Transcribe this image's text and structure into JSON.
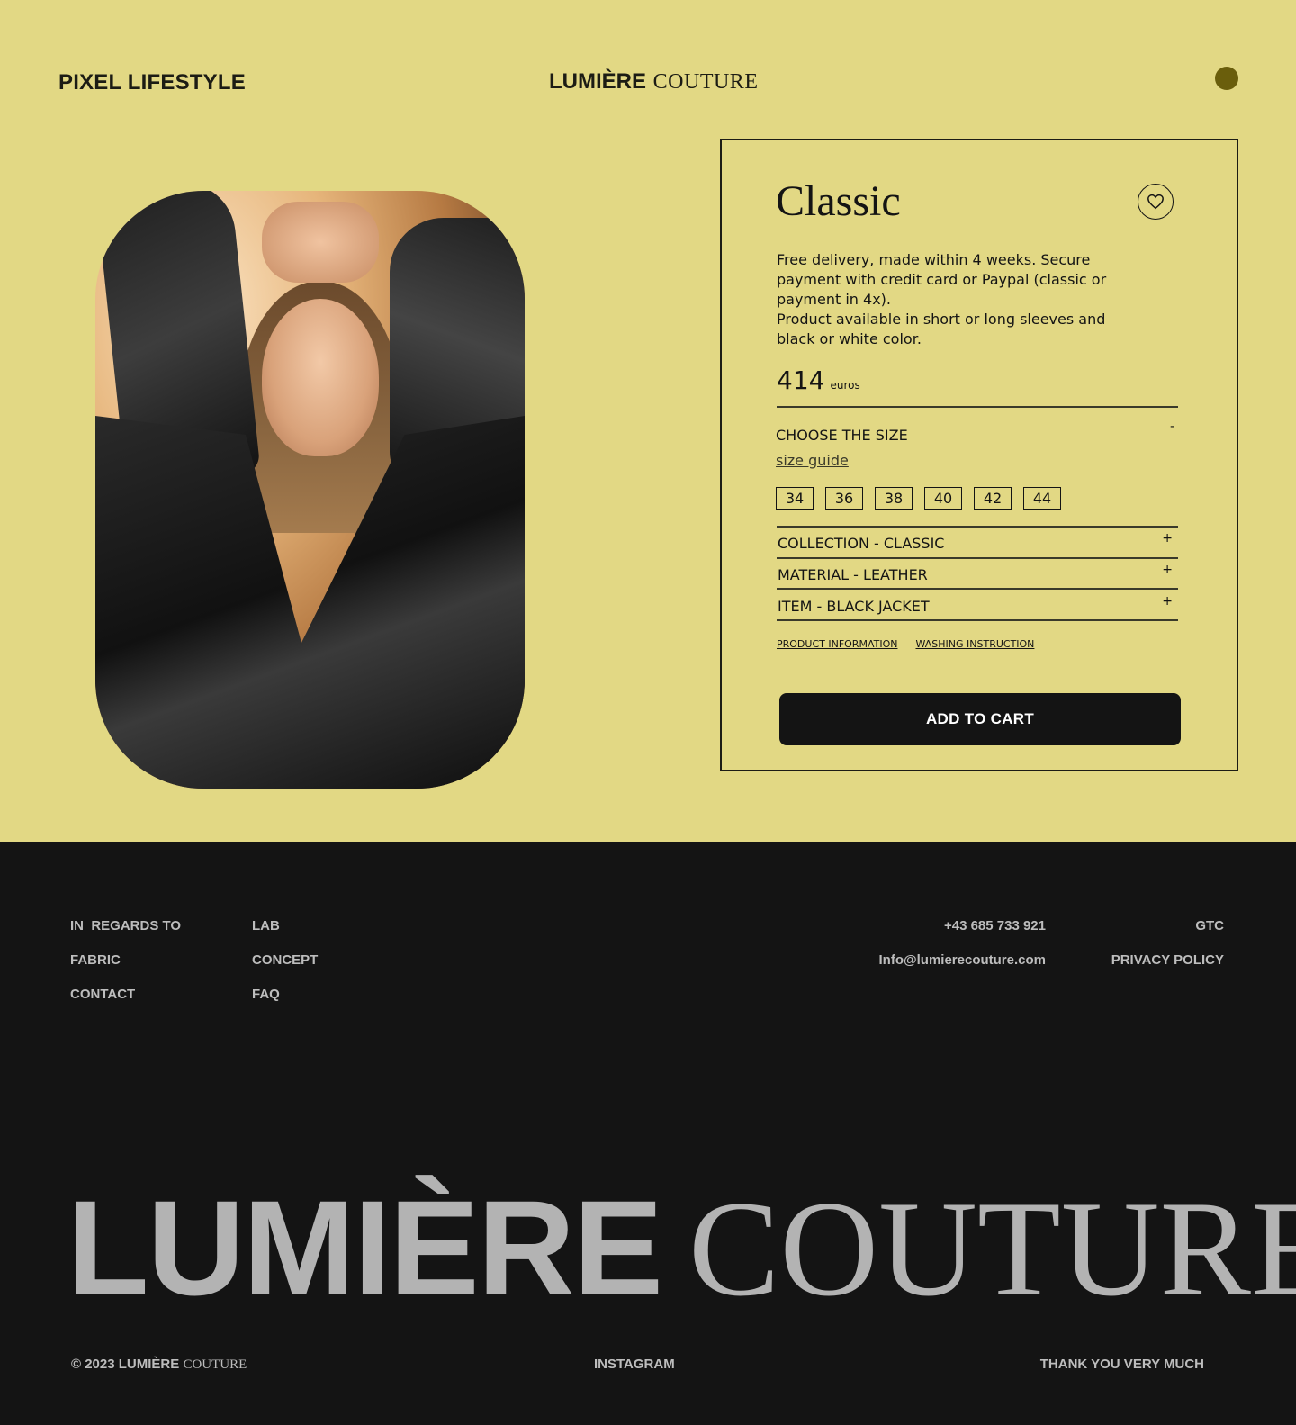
{
  "header": {
    "brand_left": "PIXEL LIFESTYLE",
    "brand_center_bold": "LUMIÈRE",
    "brand_center_serif": "COUTURE",
    "menu_dot_color": "#6a5e0c"
  },
  "product": {
    "image_alt": "Woman wearing black leather jacket",
    "title": "Classic",
    "wishlist_icon": "heart-icon",
    "description_1": "Free delivery, made within 4 weeks. Secure payment with credit card or Paypal (classic or payment in 4x).",
    "description_2": "Product available in short or long sleeves and black or white color.",
    "price": "414",
    "currency": "euros",
    "size_section": {
      "label": "CHOOSE THE SIZE",
      "toggle": "-",
      "guide": "size guide",
      "sizes": [
        "34",
        "36",
        "38",
        "40",
        "42",
        "44"
      ]
    },
    "accordions": [
      {
        "label": "COLLECTION - CLASSIC",
        "toggle": "+"
      },
      {
        "label": "MATERIAL - LEATHER",
        "toggle": "+"
      },
      {
        "label": "ITEM - BLACK JACKET",
        "toggle": "+"
      }
    ],
    "links": [
      "PRODUCT INFORMATION",
      "WASHING INSTRUCTION"
    ],
    "cta": "ADD TO CART"
  },
  "footer": {
    "col1": [
      "IN  REGARDS TO",
      "FABRIC",
      "CONTACT"
    ],
    "col2": [
      "LAB",
      "CONCEPT",
      "FAQ"
    ],
    "contact": [
      "+43 685 733 921",
      "Info@lumierecouture.com"
    ],
    "legal": [
      "GTC",
      "PRIVACY POLICY"
    ],
    "big_bold": "LUMIÈRE",
    "big_serif": "COUTURE",
    "copyright_prefix": "© 2023",
    "copyright_bold": "LUMIÈRE",
    "copyright_serif": "COUTURE",
    "instagram": "INSTAGRAM",
    "thanks": "THANK YOU VERY MUCH"
  },
  "colors": {
    "background_top": "#e2d884",
    "background_footer": "#141414",
    "button": "#141414",
    "footer_text": "#bdbdbd"
  }
}
